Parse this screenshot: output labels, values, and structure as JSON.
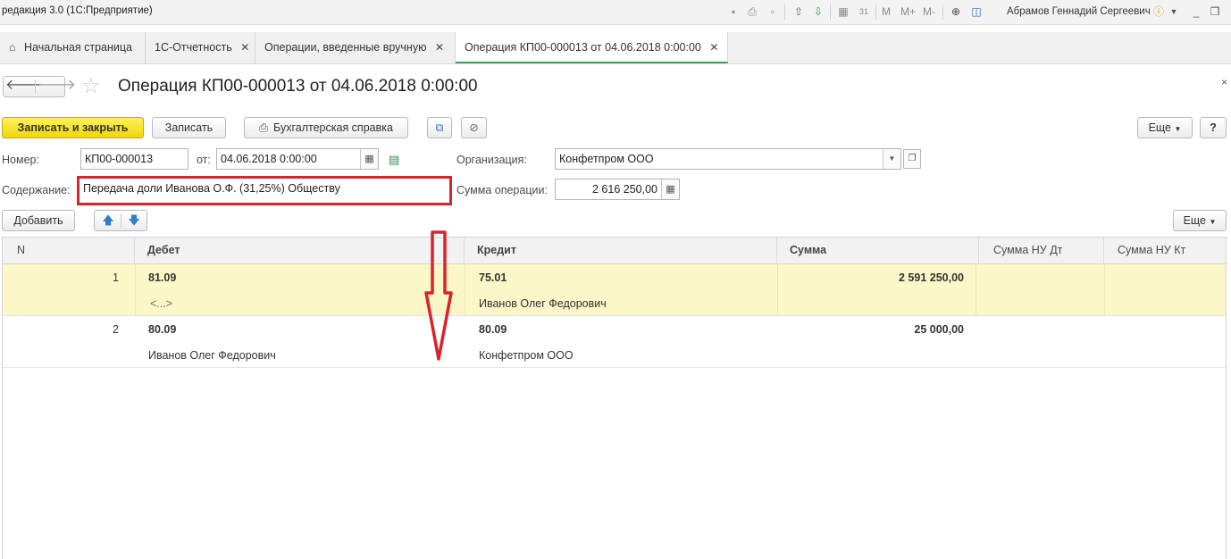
{
  "app": {
    "title": "редакция 3.0  (1С:Предприятие)",
    "user": "Абрамов Геннадий Сергеевич",
    "toolbar_icons": [
      "save-icon",
      "print-icon",
      "preview-icon",
      "upload-icon",
      "download-icon",
      "calculator-icon",
      "calendar-icon"
    ],
    "memory_labels": [
      "M",
      "M+",
      "M-"
    ]
  },
  "tabs": [
    {
      "label": "Начальная страница",
      "icon": "home-icon"
    },
    {
      "label": "1С-Отчетность"
    },
    {
      "label": "Операции, введенные вручную"
    },
    {
      "label": "Операция КП00-000013 от 04.06.2018 0:00:00",
      "active": true
    }
  ],
  "document": {
    "title": "Операция КП00-000013 от 04.06.2018 0:00:00"
  },
  "commands": {
    "save_close": "Записать и закрыть",
    "save": "Записать",
    "print_ref": "Бухгалтерская справка",
    "more": "Еще",
    "help": "?"
  },
  "form": {
    "number_label": "Номер:",
    "number_value": "КП00-000013",
    "date_label": "от:",
    "date_value": "04.06.2018  0:00:00",
    "org_label": "Организация:",
    "org_value": "Конфетпром ООО",
    "content_label": "Содержание:",
    "content_value": "Передача доли Иванова О.Ф. (31,25%) Обществу",
    "sum_label": "Сумма операции:",
    "sum_value": "2 616 250,00"
  },
  "table_bar": {
    "add": "Добавить",
    "more": "Еще"
  },
  "table": {
    "columns": [
      "N",
      "Дебет",
      "Кредит",
      "Сумма",
      "Сумма НУ Дт",
      "Сумма НУ Кт"
    ],
    "rows": [
      {
        "n": "1",
        "debit": "81.09",
        "debit_sub": "<...>",
        "credit": "75.01",
        "credit_sub": "Иванов Олег Федорович",
        "sum": "2 591 250,00",
        "selected": true
      },
      {
        "n": "2",
        "debit": "80.09",
        "debit_sub": "Иванов Олег Федорович",
        "credit": "80.09",
        "credit_sub": "Конфетпром ООО",
        "sum": "25 000,00",
        "selected": false
      }
    ]
  },
  "colors": {
    "primary_button": "#f5dc1a",
    "selected_row": "#fbf7c8",
    "annotation": "#d9232d",
    "active_tab_underline": "#4d9e5a"
  }
}
